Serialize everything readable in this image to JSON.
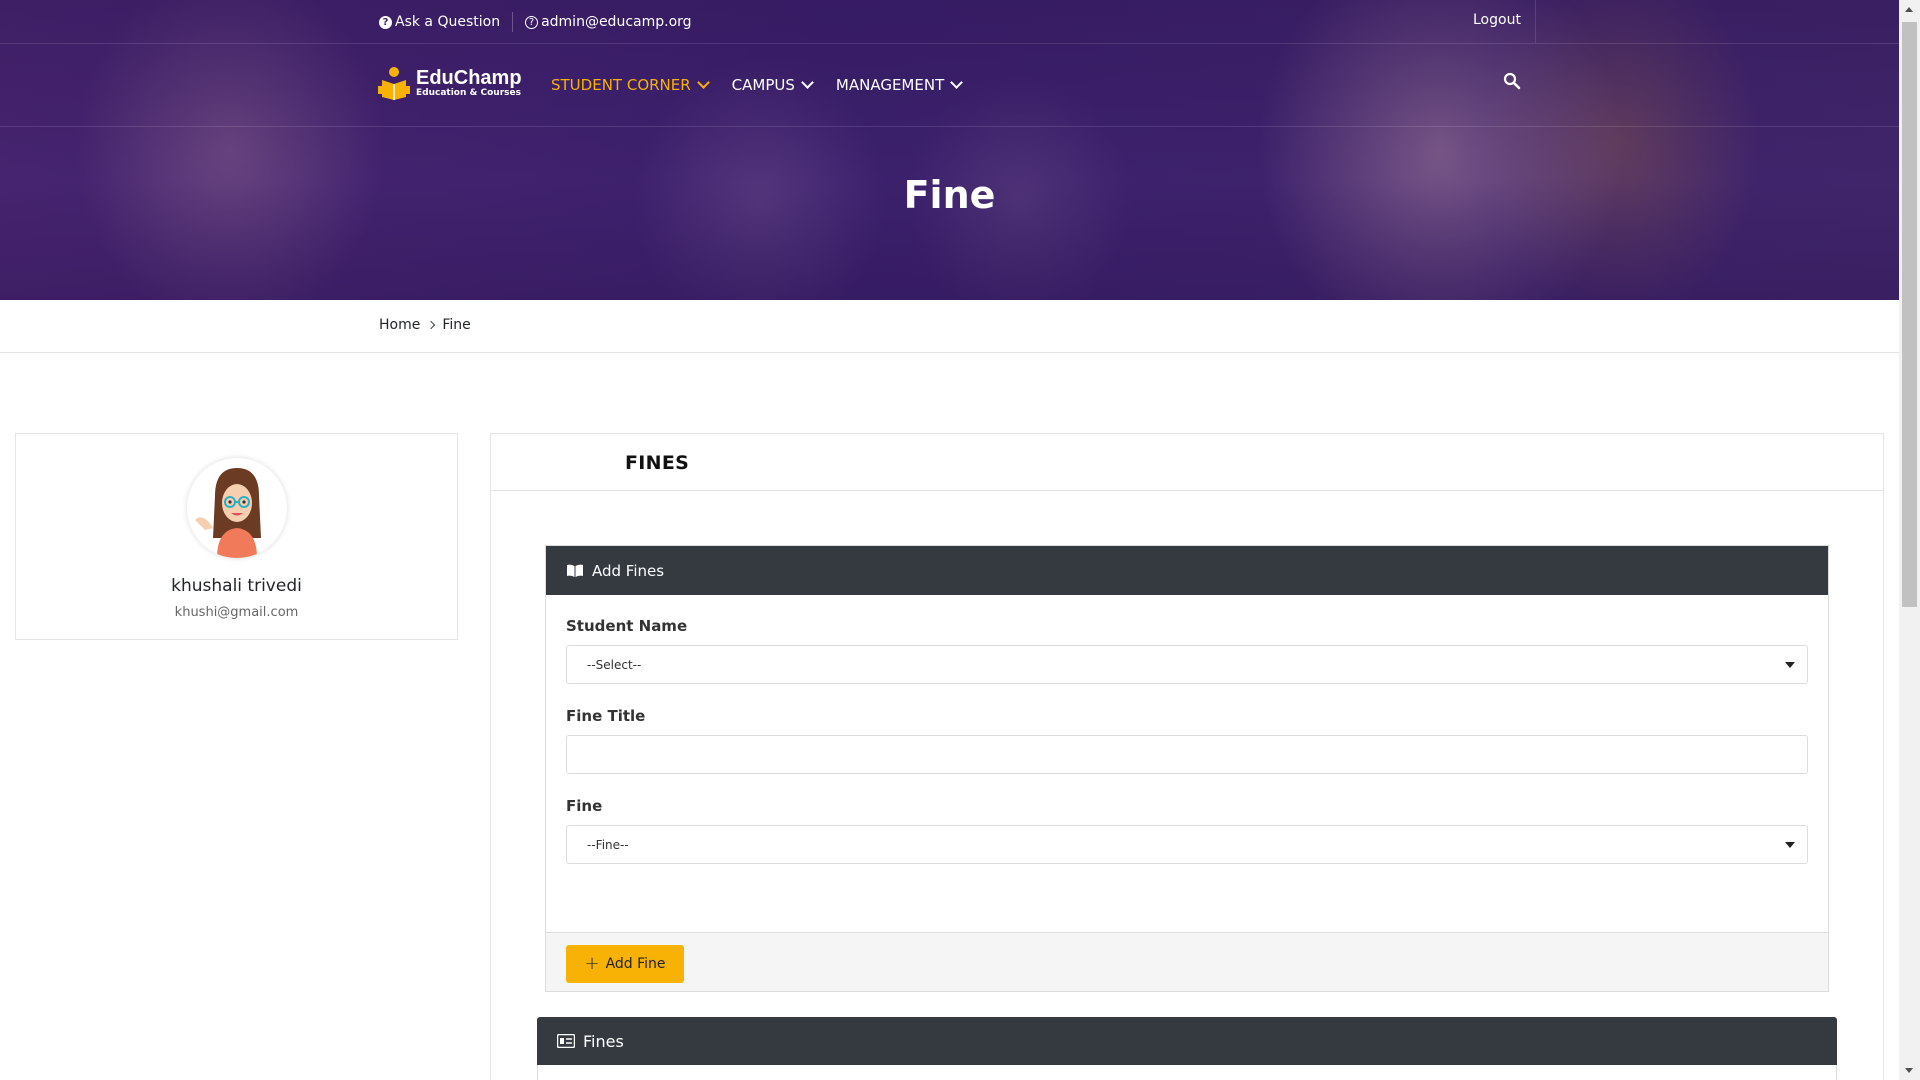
{
  "topbar": {
    "ask_label": "Ask a Question",
    "email": "admin@educamp.org",
    "logout": "Logout"
  },
  "brand": {
    "name": "EduChamp",
    "tagline": "Education & Courses",
    "accent": "#f7b205"
  },
  "nav": {
    "items": [
      {
        "label": "STUDENT CORNER",
        "active": true
      },
      {
        "label": "CAMPUS",
        "active": false
      },
      {
        "label": "MANAGEMENT",
        "active": false
      }
    ]
  },
  "hero": {
    "title": "Fine"
  },
  "breadcrumb": {
    "home": "Home",
    "current": "Fine"
  },
  "profile": {
    "name": "khushali trivedi",
    "email": "khushi@gmail.com"
  },
  "panel": {
    "title": "FINES"
  },
  "add_form": {
    "title": "Add Fines",
    "student_label": "Student Name",
    "student_value": "--Select--",
    "title_label": "Fine Title",
    "title_value": "",
    "fine_label": "Fine",
    "fine_value": "--Fine--",
    "submit": "Add Fine"
  },
  "list": {
    "title": "Fines"
  },
  "icons": [
    "question-icon",
    "help-icon",
    "search-icon",
    "book-icon",
    "id-card-icon",
    "plus-icon",
    "chevron-down-icon",
    "dropdown-caret-icon"
  ]
}
